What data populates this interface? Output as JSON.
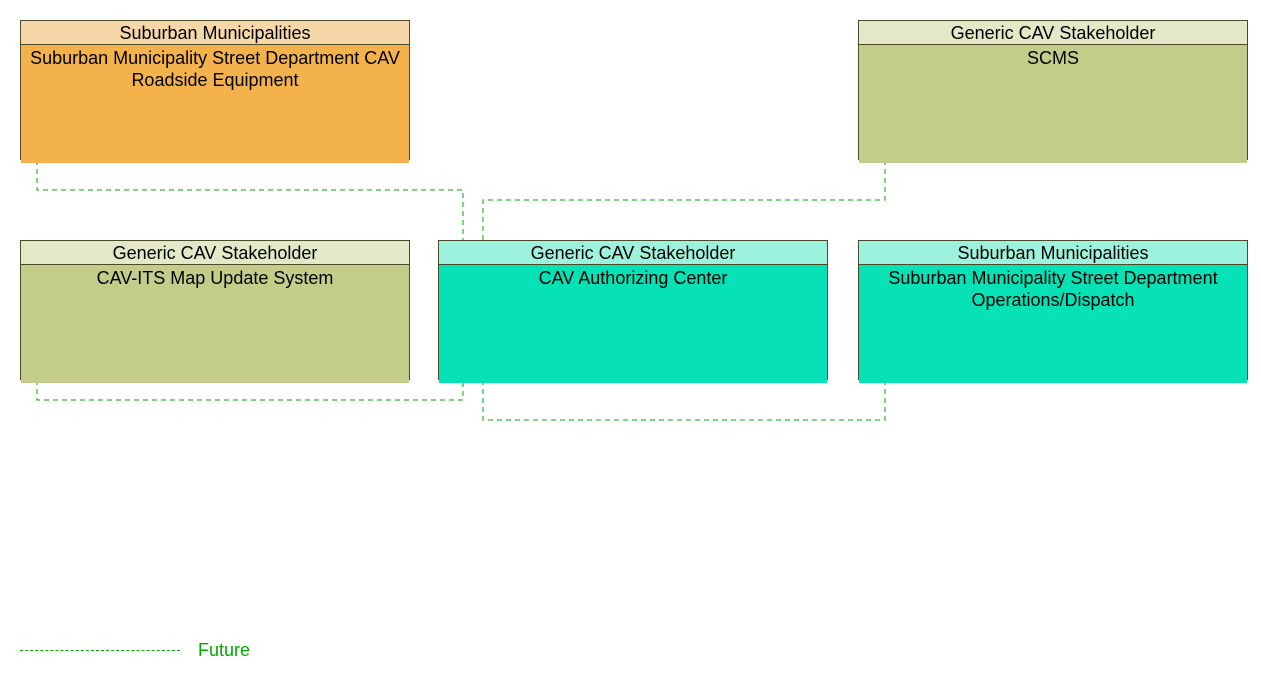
{
  "nodes": {
    "topLeft": {
      "stakeholder": "Suburban Municipalities",
      "name": "Suburban Municipality Street Department CAV Roadside Equipment"
    },
    "topRight": {
      "stakeholder": "Generic CAV Stakeholder",
      "name": "SCMS"
    },
    "midLeft": {
      "stakeholder": "Generic CAV Stakeholder",
      "name": "CAV-ITS Map Update System"
    },
    "midCenter": {
      "stakeholder": "Generic CAV Stakeholder",
      "name": "CAV Authorizing Center"
    },
    "midRight": {
      "stakeholder": "Suburban Municipalities",
      "name": "Suburban Municipality Street Department Operations/Dispatch"
    }
  },
  "legend": {
    "future": "Future"
  },
  "colors": {
    "orangeHeader": "#f6d7a7",
    "orangeBody": "#f3b24b",
    "oliveHeader": "#e3e8c7",
    "oliveBody": "#c3cd89",
    "tealHeader": "#9cf2dc",
    "tealBody": "#06e1b5",
    "tealHeader2": "#9cf2dc",
    "border": "#4a4a2a",
    "wire": "#00aa00"
  }
}
